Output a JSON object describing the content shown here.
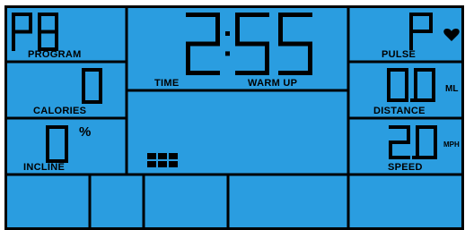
{
  "colors": {
    "panel": "#2a9de0",
    "ink": "#000000",
    "page": "#ffffff"
  },
  "program": {
    "value": "P8",
    "label": "PROGRAM"
  },
  "calories": {
    "value": "0",
    "label": "CALORIES"
  },
  "incline": {
    "value": "0",
    "unit": "%",
    "label": "INCLINE"
  },
  "time": {
    "value": "2:55",
    "label": "TIME"
  },
  "mode": {
    "label": "WARM UP"
  },
  "pulse": {
    "value": "P",
    "label": "PULSE",
    "icon": "heart-icon"
  },
  "distance": {
    "value": "0.0",
    "unit": "ML",
    "label": "DISTANCE"
  },
  "speed": {
    "value": "2.0",
    "unit": "MPH",
    "label": "SPEED"
  },
  "profile": {
    "icon": "profile-blocks-icon",
    "rows": 2,
    "cols": 3
  }
}
